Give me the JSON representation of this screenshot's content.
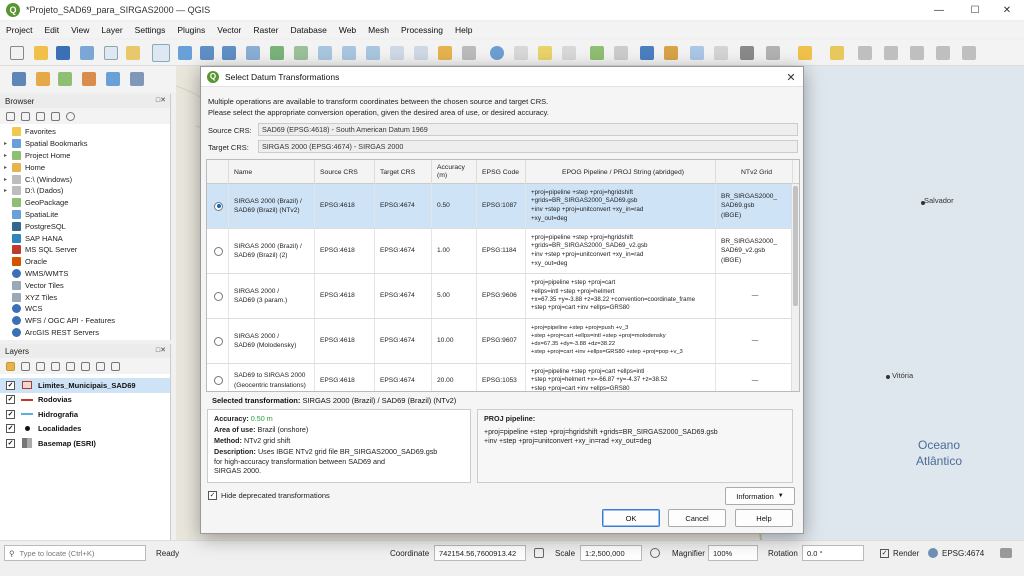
{
  "window": {
    "title": "*Projeto_SAD69_para_SIRGAS2000 — QGIS",
    "logo": "Q"
  },
  "menu": [
    "Project",
    "Edit",
    "View",
    "Layer",
    "Settings",
    "Plugins",
    "Vector",
    "Raster",
    "Database",
    "Web",
    "Mesh",
    "Processing",
    "Help"
  ],
  "browser": {
    "title": "Browser",
    "items": [
      "Favorites",
      "Spatial Bookmarks",
      "Project Home",
      "Home",
      "C:\\ (Windows)",
      "D:\\ (Dados)",
      "GeoPackage",
      "SpatiaLite",
      "PostgreSQL",
      "SAP HANA",
      "MS SQL Server",
      "Oracle",
      "WMS/WMTS",
      "Vector Tiles",
      "XYZ Tiles",
      "WCS",
      "WFS / OGC API - Features",
      "ArcGIS REST Servers"
    ]
  },
  "layers": {
    "title": "Layers",
    "items": [
      "Limites_Municipais_SAD69",
      "Rodovias",
      "Hidrografia",
      "Localidades",
      "Basemap (ESRI)"
    ]
  },
  "map": {
    "city1": "Salvador",
    "city2": "Vitória",
    "ocean_line1": "Oceano",
    "ocean_line2": "Atlântico"
  },
  "dialog": {
    "title": "Select Datum Transformations",
    "intro1": "Multiple operations are available to transform coordinates between the chosen source and target CRS.",
    "intro2": "Please select the appropriate conversion operation, given the desired area of use, or desired accuracy.",
    "source_label": "Source CRS:",
    "source_value": "SAD69 (EPSG:4618) - South American Datum 1969",
    "target_label": "Target CRS:",
    "target_value": "SIRGAS 2000 (EPSG:4674) - SIRGAS 2000",
    "columns": [
      "Name",
      "Source CRS",
      "Target CRS",
      "Accuracy\n(m)",
      "EPSG Code",
      "EPOG Pipeline / PROJ String (abridged)",
      "NTv2 Grid"
    ],
    "rows": [
      {
        "name": "SIRGAS 2000 (Brazil) /\nSAD69 (Brazil) (NTv2)",
        "src": "EPSG:4618",
        "tgt": "EPSG:4674",
        "acc": "0.50",
        "epsg": "EPSG:1087",
        "pipeline": "+proj=pipeline +step +proj=hgridshift\n+grids=BR_SIRGAS2000_SAD69.gsb\n+inv +step +proj=unitconvert +xy_in=rad\n+xy_out=deg",
        "grid": "BR_SIRGAS2000_\nSAD69.gsb\n(IBGE)"
      },
      {
        "name": "SIRGAS 2000 (Brazil) /\nSAD69 (Brazil) (2)",
        "src": "EPSG:4618",
        "tgt": "EPSG:4674",
        "acc": "1.00",
        "epsg": "EPSG:1184",
        "pipeline": "+proj=pipeline +step +proj=hgridshift\n+grids=BR_SIRGAS2000_SAD69_v2.gsb\n+inv +step +proj=unitconvert +xy_in=rad\n+xy_out=deg",
        "grid": "BR_SIRGAS2000_\nSAD69_v2.gsb\n(IBGE)"
      },
      {
        "name": "SIRGAS 2000 /\nSAD69 (3 param.)",
        "src": "EPSG:4618",
        "tgt": "EPSG:4674",
        "acc": "5.00",
        "epsg": "EPSG:9606",
        "pipeline": "+proj=pipeline +step +proj=cart\n+ellps=intl +step +proj=helmert\n+x=67.35 +y=-3.88 +z=38.22 +convention=coordinate_frame\n+step +proj=cart +inv +ellps=GRS80",
        "grid": "—"
      },
      {
        "name": "SIRGAS 2000 /\nSAD69 (Molodensky)",
        "src": "EPSG:4618",
        "tgt": "EPSG:4674",
        "acc": "10.00",
        "epsg": "EPSG:9607",
        "pipeline": "+proj=pipeline +step +proj=push +v_3\n+step +proj=cart +ellps=intl +step +proj=molodensky\n+dx=67.35 +dy=-3.88 +dz=38.22\n+step +proj=cart +inv +ellps=GRS80 +step +proj=pop +v_3",
        "grid": "—"
      },
      {
        "name": "SAD69 to SIRGAS 2000\n(Geocentric translations)",
        "src": "EPSG:4618",
        "tgt": "EPSG:4674",
        "acc": "20.00",
        "epsg": "EPSG:1053",
        "pipeline": "+proj=pipeline +step +proj=cart +ellps=intl\n+step +proj=helmert +x=-66.87 +y=-4.37 +z=38.52\n+step +proj=cart +inv +ellps=GRS80",
        "grid": "—"
      }
    ],
    "selected_label": "Selected transformation:",
    "selected_value": "SIRGAS 2000 (Brazil) / SAD69 (Brazil) (NTv2)",
    "details": {
      "accuracy_label": "Accuracy:",
      "accuracy_value": "0.50 m",
      "area_label": "Area of use:",
      "area_value": "Brazil (onshore)",
      "method_label": "Method:",
      "method_value": "NTv2 grid shift",
      "desc_label": "Description:",
      "desc_value": "Uses IBGE NTv2 grid file BR_SIRGAS2000_SAD69.gsb\nfor high-accuracy transformation between SAD69 and\nSIRGAS 2000."
    },
    "proj_title": "PROJ pipeline:",
    "proj_text": "+proj=pipeline +step +proj=hgridshift +grids=BR_SIRGAS2000_SAD69.gsb\n+inv +step +proj=unitconvert +xy_in=rad +xy_out=deg",
    "hide_deprecated": "Hide deprecated transformations",
    "info_button": "Information",
    "ok": "OK",
    "cancel": "Cancel",
    "help": "Help"
  },
  "status": {
    "locate_placeholder": "Type to locate (Ctrl+K)",
    "ready": "Ready",
    "coord_label": "Coordinate",
    "coord_value": "742154.56,7600913.42",
    "scale_label": "Scale",
    "scale_value": "1:2,500,000",
    "magnifier_label": "Magnifier",
    "magnifier_value": "100%",
    "rotation_label": "Rotation",
    "rotation_value": "0.0 °",
    "render_label": "Render",
    "epsg": "EPSG:4674"
  },
  "colors": {
    "accent": "#589632",
    "selection": "#cfe3f6",
    "accuracy_green": "#2e9e3a",
    "ocean_text": "#4a6c97"
  }
}
